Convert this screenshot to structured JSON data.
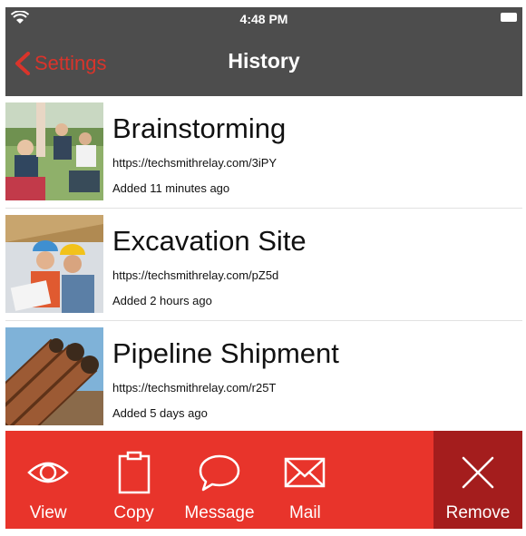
{
  "status_bar": {
    "time": "4:48 PM"
  },
  "nav": {
    "back_label": "Settings",
    "title": "History"
  },
  "items": [
    {
      "title": "Brainstorming",
      "url": "https://techsmithrelay.com/3iPY",
      "added": "Added 11 minutes ago",
      "thumb_icon": "people-outdoors-photo"
    },
    {
      "title": "Excavation Site",
      "url": "https://techsmithrelay.com/pZ5d",
      "added": "Added 2 hours ago",
      "thumb_icon": "construction-workers-photo"
    },
    {
      "title": "Pipeline Shipment",
      "url": "https://techsmithrelay.com/r25T",
      "added": "Added 5 days ago",
      "thumb_icon": "pipes-photo"
    }
  ],
  "actions": {
    "view": "View",
    "copy": "Copy",
    "message": "Message",
    "mail": "Mail",
    "remove": "Remove"
  },
  "colors": {
    "nav_bg": "#4d4d4d",
    "accent_red": "#e8342b",
    "remove_red": "#a41d1d",
    "back_red": "#d9342b"
  }
}
